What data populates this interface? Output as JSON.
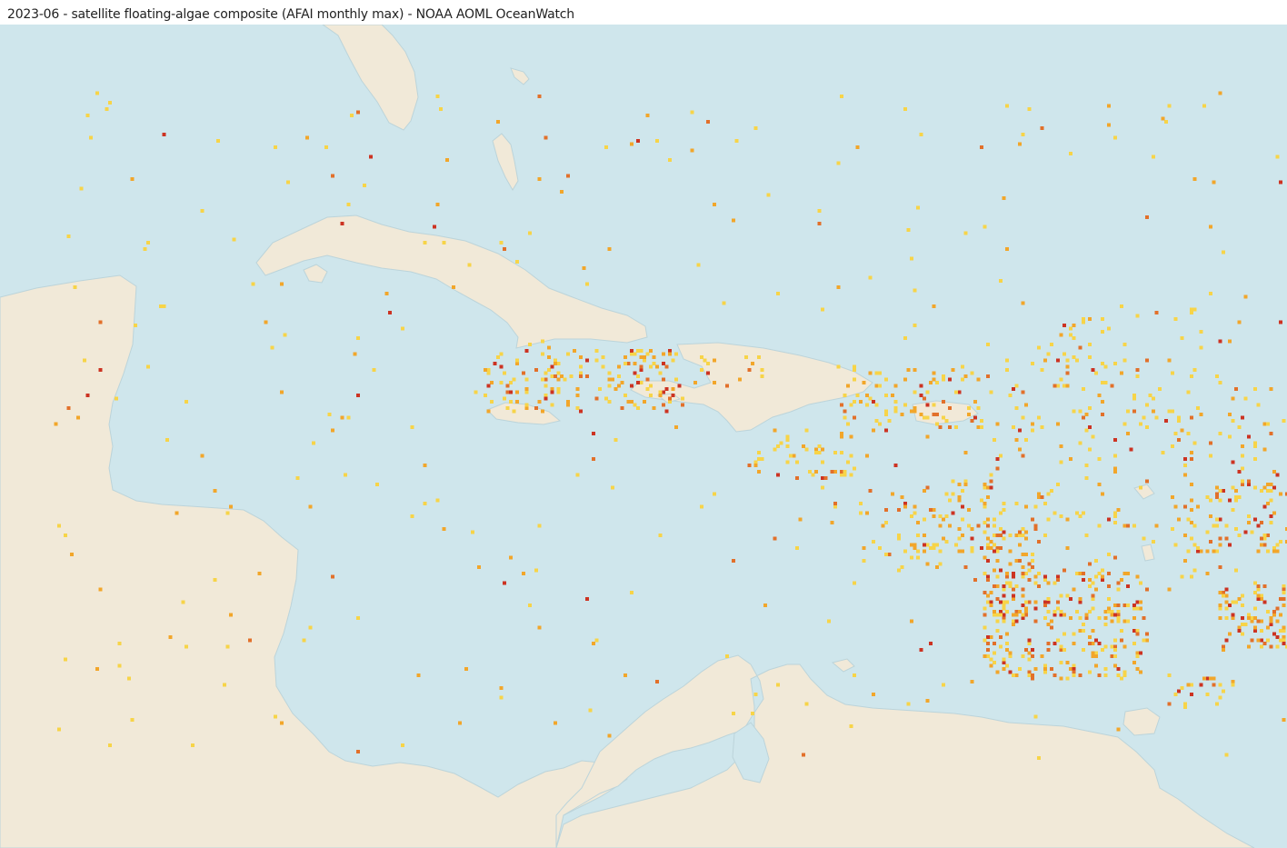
{
  "header": {
    "title": "2023-06 - satellite floating-algae composite (AFAI monthly max) - NOAA AOML OceanWatch"
  },
  "map": {
    "ocean_color": "#cfe6ec",
    "land_color": "#f1e9d8",
    "coast_color": "#bcd4da",
    "algae_classes": [
      {
        "level": "low",
        "color": "#f7d448"
      },
      {
        "level": "medium",
        "color": "#f2a62a"
      },
      {
        "level": "high",
        "color": "#e2702a"
      },
      {
        "level": "very-high",
        "color": "#cc3322"
      }
    ]
  }
}
